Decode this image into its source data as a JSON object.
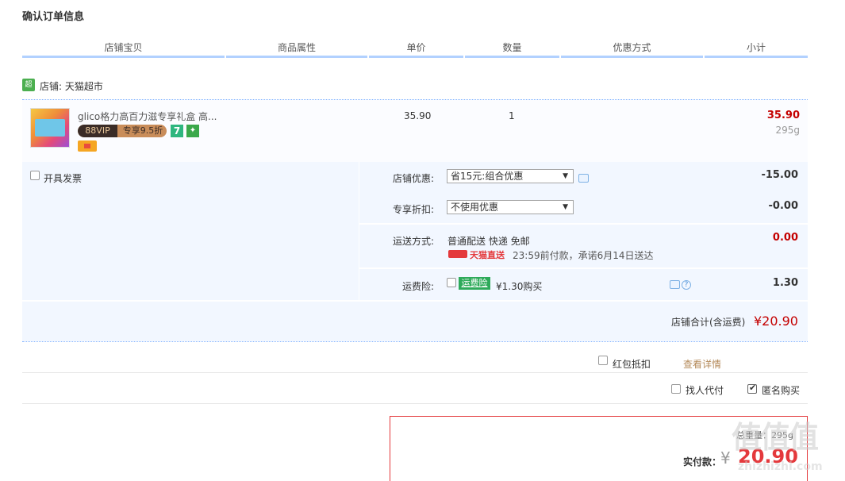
{
  "page_title": "确认订单信息",
  "headers": [
    "店铺宝贝",
    "商品属性",
    "单价",
    "数量",
    "优惠方式",
    "小计"
  ],
  "shop": {
    "icon_text": "超市",
    "name": "店铺: 天猫超市"
  },
  "item": {
    "name": "glico格力高百力滋专享礼盒 高...",
    "vip_left": "88VIP",
    "vip_right": "专享9.5折",
    "badge7": "7",
    "badge_g": "",
    "price": "35.90",
    "qty": "1",
    "subtotal": "35.90",
    "weight": "295g"
  },
  "invoice_label": "开具发票",
  "shop_discount": {
    "label": "店铺优惠:",
    "value": "省15元:组合优惠",
    "amount": "-15.00"
  },
  "vip_discount": {
    "label": "专享折扣:",
    "value": "不使用优惠",
    "amount": "-0.00"
  },
  "shipping": {
    "label": "运送方式:",
    "method": "普通配送 快递 免邮",
    "tmall_direct": "天猫直送",
    "eta": "23:59前付款，承诺6月14日送达",
    "amount": "0.00"
  },
  "insurance": {
    "label": "运费险:",
    "tag": "运费险",
    "price": "¥1.30购买",
    "amount": "1.30"
  },
  "shop_total": {
    "label": "店铺合计(含运费)",
    "amount": "¥20.90"
  },
  "red_packet": {
    "label": "红包抵扣",
    "link": "查看详情"
  },
  "proxy": {
    "label": "找人代付"
  },
  "anon": {
    "label": "匿名购买"
  },
  "summary": {
    "weight": "总重量：295g",
    "pay_label": "实付款：",
    "currency": "¥",
    "pay_amount": "20.90"
  },
  "watermark": {
    "main": "值值值",
    "sub": "zhizhizhi.com"
  }
}
